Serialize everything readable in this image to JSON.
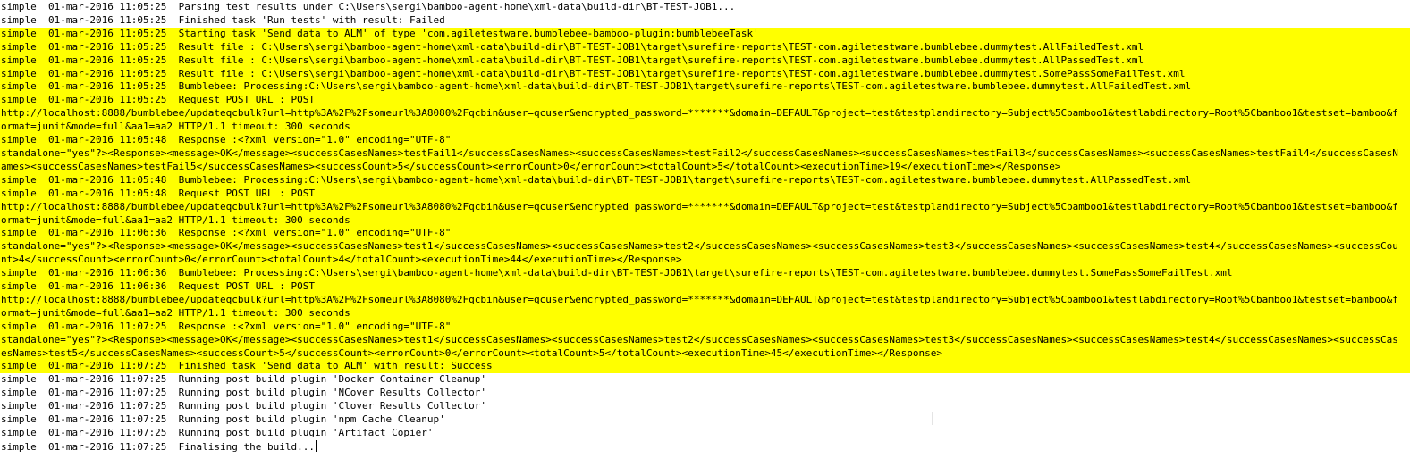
{
  "theme": {
    "background": "#ffffff",
    "text": "#000000",
    "highlight": "#ffff00"
  },
  "log": [
    {
      "text": "simple  01-mar-2016 11:05:25  Parsing test results under C:\\Users\\sergi\\bamboo-agent-home\\xml-data\\build-dir\\BT-TEST-JOB1...",
      "highlighted": false
    },
    {
      "text": "simple  01-mar-2016 11:05:25  Finished task 'Run tests' with result: Failed",
      "highlighted": false
    },
    {
      "text": "simple  01-mar-2016 11:05:25  Starting task 'Send data to ALM' of type 'com.agiletestware.bumblebee-bamboo-plugin:bumblebeeTask'",
      "highlighted": true
    },
    {
      "text": "simple  01-mar-2016 11:05:25  Result file : C:\\Users\\sergi\\bamboo-agent-home\\xml-data\\build-dir\\BT-TEST-JOB1\\target\\surefire-reports\\TEST-com.agiletestware.bumblebee.dummytest.AllFailedTest.xml",
      "highlighted": true
    },
    {
      "text": "simple  01-mar-2016 11:05:25  Result file : C:\\Users\\sergi\\bamboo-agent-home\\xml-data\\build-dir\\BT-TEST-JOB1\\target\\surefire-reports\\TEST-com.agiletestware.bumblebee.dummytest.AllPassedTest.xml",
      "highlighted": true
    },
    {
      "text": "simple  01-mar-2016 11:05:25  Result file : C:\\Users\\sergi\\bamboo-agent-home\\xml-data\\build-dir\\BT-TEST-JOB1\\target\\surefire-reports\\TEST-com.agiletestware.bumblebee.dummytest.SomePassSomeFailTest.xml",
      "highlighted": true
    },
    {
      "text": "simple  01-mar-2016 11:05:25  Bumblebee: Processing:C:\\Users\\sergi\\bamboo-agent-home\\xml-data\\build-dir\\BT-TEST-JOB1\\target\\surefire-reports\\TEST-com.agiletestware.bumblebee.dummytest.AllFailedTest.xml",
      "highlighted": true
    },
    {
      "text": "simple  01-mar-2016 11:05:25  Request POST URL : POST",
      "highlighted": true
    },
    {
      "text": "http://localhost:8888/bumblebee/updateqcbulk?url=http%3A%2F%2Fsomeurl%3A8080%2Fqcbin&user=qcuser&encrypted_password=*******&domain=DEFAULT&project=test&testplandirectory=Subject%5Cbamboo1&testlabdirectory=Root%5Cbamboo1&testset=bamboo&format=junit&mode=full&aa1=aa2 HTTP/1.1 timeout: 300 seconds",
      "highlighted": true
    },
    {
      "text": "simple  01-mar-2016 11:05:48  Response :<?xml version=\"1.0\" encoding=\"UTF-8\"",
      "highlighted": true
    },
    {
      "text": "standalone=\"yes\"?><Response><message>OK</message><successCasesNames>testFail1</successCasesNames><successCasesNames>testFail2</successCasesNames><successCasesNames>testFail3</successCasesNames><successCasesNames>testFail4</successCasesNames><successCasesNames>testFail5</successCasesNames><successCount>5</successCount><errorCount>0</errorCount><totalCount>5</totalCount><executionTime>19</executionTime></Response>",
      "highlighted": true
    },
    {
      "text": "simple  01-mar-2016 11:05:48  Bumblebee: Processing:C:\\Users\\sergi\\bamboo-agent-home\\xml-data\\build-dir\\BT-TEST-JOB1\\target\\surefire-reports\\TEST-com.agiletestware.bumblebee.dummytest.AllPassedTest.xml",
      "highlighted": true
    },
    {
      "text": "simple  01-mar-2016 11:05:48  Request POST URL : POST",
      "highlighted": true
    },
    {
      "text": "http://localhost:8888/bumblebee/updateqcbulk?url=http%3A%2F%2Fsomeurl%3A8080%2Fqcbin&user=qcuser&encrypted_password=*******&domain=DEFAULT&project=test&testplandirectory=Subject%5Cbamboo1&testlabdirectory=Root%5Cbamboo1&testset=bamboo&format=junit&mode=full&aa1=aa2 HTTP/1.1 timeout: 300 seconds",
      "highlighted": true
    },
    {
      "text": "simple  01-mar-2016 11:06:36  Response :<?xml version=\"1.0\" encoding=\"UTF-8\"",
      "highlighted": true
    },
    {
      "text": "standalone=\"yes\"?><Response><message>OK</message><successCasesNames>test1</successCasesNames><successCasesNames>test2</successCasesNames><successCasesNames>test3</successCasesNames><successCasesNames>test4</successCasesNames><successCount>4</successCount><errorCount>0</errorCount><totalCount>4</totalCount><executionTime>44</executionTime></Response>",
      "highlighted": true
    },
    {
      "text": "simple  01-mar-2016 11:06:36  Bumblebee: Processing:C:\\Users\\sergi\\bamboo-agent-home\\xml-data\\build-dir\\BT-TEST-JOB1\\target\\surefire-reports\\TEST-com.agiletestware.bumblebee.dummytest.SomePassSomeFailTest.xml",
      "highlighted": true
    },
    {
      "text": "simple  01-mar-2016 11:06:36  Request POST URL : POST",
      "highlighted": true
    },
    {
      "text": "http://localhost:8888/bumblebee/updateqcbulk?url=http%3A%2F%2Fsomeurl%3A8080%2Fqcbin&user=qcuser&encrypted_password=*******&domain=DEFAULT&project=test&testplandirectory=Subject%5Cbamboo1&testlabdirectory=Root%5Cbamboo1&testset=bamboo&format=junit&mode=full&aa1=aa2 HTTP/1.1 timeout: 300 seconds",
      "highlighted": true
    },
    {
      "text": "simple  01-mar-2016 11:07:25  Response :<?xml version=\"1.0\" encoding=\"UTF-8\"",
      "highlighted": true
    },
    {
      "text": "standalone=\"yes\"?><Response><message>OK</message><successCasesNames>test1</successCasesNames><successCasesNames>test2</successCasesNames><successCasesNames>test3</successCasesNames><successCasesNames>test4</successCasesNames><successCasesNames>test5</successCasesNames><successCount>5</successCount><errorCount>0</errorCount><totalCount>5</totalCount><executionTime>45</executionTime></Response>",
      "highlighted": true
    },
    {
      "text": "simple  01-mar-2016 11:07:25  Finished task 'Send data to ALM' with result: Success",
      "highlighted": true
    },
    {
      "text": "simple  01-mar-2016 11:07:25  Running post build plugin 'Docker Container Cleanup'",
      "highlighted": false
    },
    {
      "text": "simple  01-mar-2016 11:07:25  Running post build plugin 'NCover Results Collector'",
      "highlighted": false
    },
    {
      "text": "simple  01-mar-2016 11:07:25  Running post build plugin 'Clover Results Collector'",
      "highlighted": false
    },
    {
      "text": "simple  01-mar-2016 11:07:25  Running post build plugin 'npm Cache Cleanup'",
      "highlighted": false
    },
    {
      "text": "simple  01-mar-2016 11:07:25  Running post build plugin 'Artifact Copier'",
      "highlighted": false
    },
    {
      "text": "simple  01-mar-2016 11:07:25  Finalising the build...",
      "highlighted": false
    }
  ]
}
